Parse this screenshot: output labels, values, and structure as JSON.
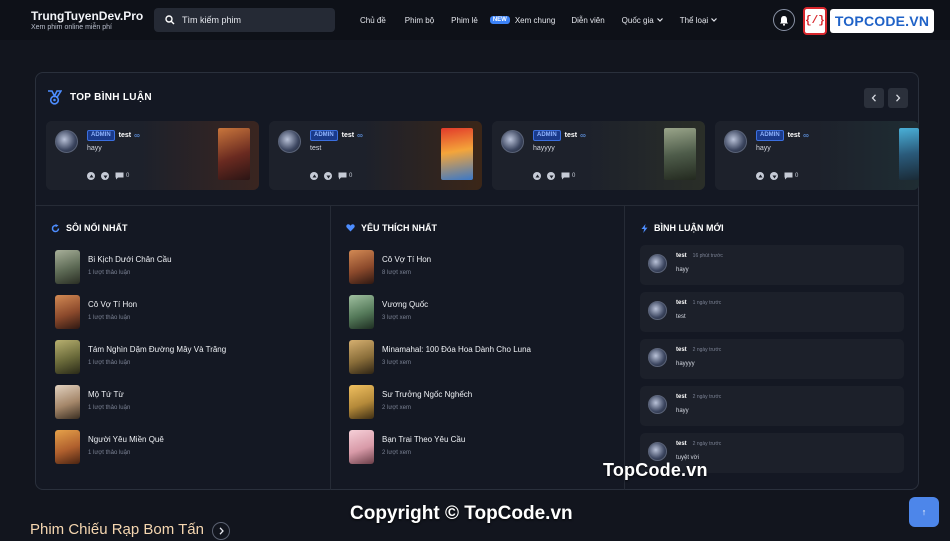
{
  "header": {
    "brand_name": "TrungTuyenDev.Pro",
    "brand_tagline": "Xem phim online miễn phí",
    "search_placeholder": "Tìm kiếm phim",
    "nav": [
      {
        "label": "Chủ đề"
      },
      {
        "label": "Phim bộ"
      },
      {
        "label": "Phim lẻ"
      },
      {
        "label": "Xem chung",
        "badge": "NEW"
      },
      {
        "label": "Diễn viên"
      },
      {
        "label": "Quốc gia",
        "dropdown": true
      },
      {
        "label": "Thể loại",
        "dropdown": true
      }
    ],
    "logo_mark": "{/}",
    "logo_text": "TOPCODE.VN"
  },
  "top_comments": {
    "title": "TOP BÌNH LUẬN",
    "cards": [
      {
        "badge": "ADMIN",
        "user": "test",
        "text": "hayy",
        "likes": "0",
        "poster": "#8a3b2a"
      },
      {
        "badge": "ADMIN",
        "user": "test",
        "text": "test",
        "likes": "0",
        "poster": "#c95a2a"
      },
      {
        "badge": "ADMIN",
        "user": "test",
        "text": "hayyyy",
        "likes": "0",
        "poster": "#4e6c5a"
      },
      {
        "badge": "ADMIN",
        "user": "test",
        "text": "hayy",
        "likes": "0",
        "poster": "#2d7a9a"
      }
    ]
  },
  "hot": {
    "title": "SÔI NỔI NHẤT",
    "items": [
      {
        "name": "Bi Kịch Dưới Chân Cầu",
        "sub": "1 lượt thảo luận",
        "color": "#5d6a55"
      },
      {
        "name": "Cô Vợ Tí Hon",
        "sub": "1 lượt thảo luận",
        "color": "#8c4a2c"
      },
      {
        "name": "Tám Nghìn Dặm Đường Mây Và Trăng",
        "sub": "1 lượt thảo luận",
        "color": "#6a6a3a"
      },
      {
        "name": "Mộ Tứ Từ",
        "sub": "1 lượt thảo luận",
        "color": "#a5876a"
      },
      {
        "name": "Người Yêu Miền Quê",
        "sub": "1 lượt thảo luận",
        "color": "#b0602e"
      }
    ]
  },
  "favorite": {
    "title": "YÊU THÍCH NHẤT",
    "items": [
      {
        "name": "Cô Vợ Tí Hon",
        "sub": "8 lượt xem",
        "color": "#8c4a2c"
      },
      {
        "name": "Vương Quốc",
        "sub": "3 lượt xem",
        "color": "#557a5a"
      },
      {
        "name": "Minamahal: 100 Đóa Hoa Dành Cho Luna",
        "sub": "3 lượt xem",
        "color": "#8a6e3a"
      },
      {
        "name": "Sư Trưởng Ngốc Nghếch",
        "sub": "2 lượt xem",
        "color": "#b58a3a"
      },
      {
        "name": "Bạn Trai Theo Yêu Cầu",
        "sub": "2 lượt xem",
        "color": "#d89aa8"
      }
    ]
  },
  "new_comments": {
    "title": "BÌNH LUẬN MỚI",
    "items": [
      {
        "user": "test",
        "time": "16 phút trước",
        "text": "hayy"
      },
      {
        "user": "test",
        "time": "1 ngày trước",
        "text": "test"
      },
      {
        "user": "test",
        "time": "2 ngày trước",
        "text": "hayyyy"
      },
      {
        "user": "test",
        "time": "2 ngày trước",
        "text": "hayy"
      },
      {
        "user": "test",
        "time": "2 ngày trước",
        "text": "tuyệt vời"
      }
    ]
  },
  "watermark": {
    "top": "TopCode.vn",
    "bottom": "Copyright © TopCode.vn"
  },
  "section": {
    "title": "Phim Chiếu Rạp Bom Tấn"
  },
  "scroll_top": {
    "label": "↑"
  },
  "colors": {
    "accent": "#3b82f6",
    "background": "#12151e",
    "card": "#141823"
  }
}
